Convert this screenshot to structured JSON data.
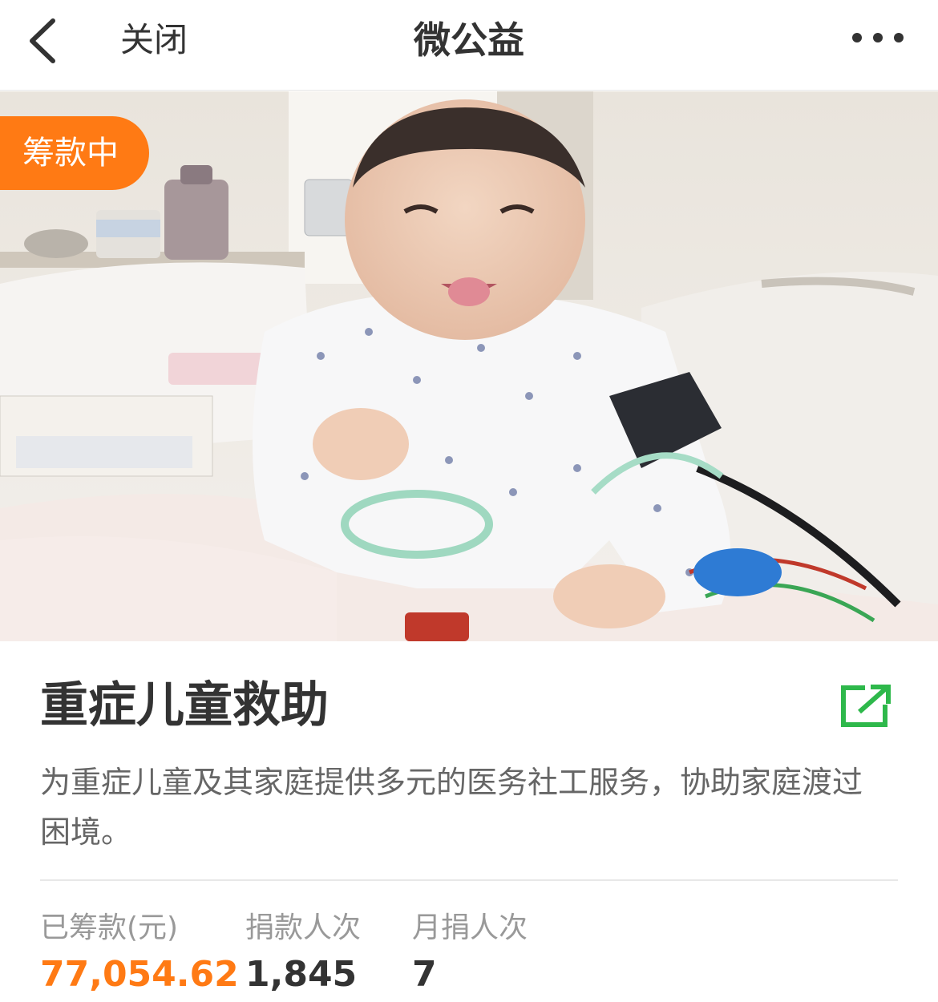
{
  "nav": {
    "close_label": "关闭",
    "title": "微公益",
    "back_icon": "chevron-left-icon",
    "more_icon": "more-dots-icon"
  },
  "hero": {
    "badge": "筹款中",
    "badge_color": "#ff7a14",
    "slides_count": 3,
    "active_slide": 3
  },
  "project": {
    "title": "重症儿童救助",
    "description": "为重症儿童及其家庭提供多元的医务社工服务，协助家庭渡过困境。",
    "share_icon": "share-external-icon",
    "share_color": "#2eb84b"
  },
  "stats": {
    "raised_label": "已筹款(元)",
    "raised_value": "77,054.62",
    "donors_label": "捐款人次",
    "donors_value": "1,845",
    "monthly_label": "月捐人次",
    "monthly_value": "7"
  }
}
